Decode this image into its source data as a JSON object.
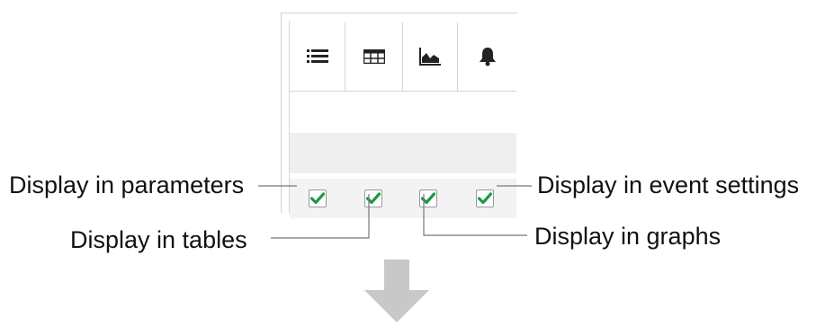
{
  "toolbar_icons": [
    {
      "icon": "list-icon"
    },
    {
      "icon": "table-icon"
    },
    {
      "icon": "graph-icon"
    },
    {
      "icon": "bell-icon"
    }
  ],
  "checkboxes": [
    {
      "name": "parameters",
      "checked": true
    },
    {
      "name": "tables",
      "checked": true
    },
    {
      "name": "graphs",
      "checked": true
    },
    {
      "name": "event-settings",
      "checked": true
    }
  ],
  "callouts": {
    "parameters": "Display in parameters",
    "tables": "Display in tables",
    "graphs": "Display in graphs",
    "event_settings": "Display in event settings"
  },
  "colors": {
    "check": "#1a9a4a",
    "arrow": "#c8c8c8",
    "leader": "#777777"
  }
}
